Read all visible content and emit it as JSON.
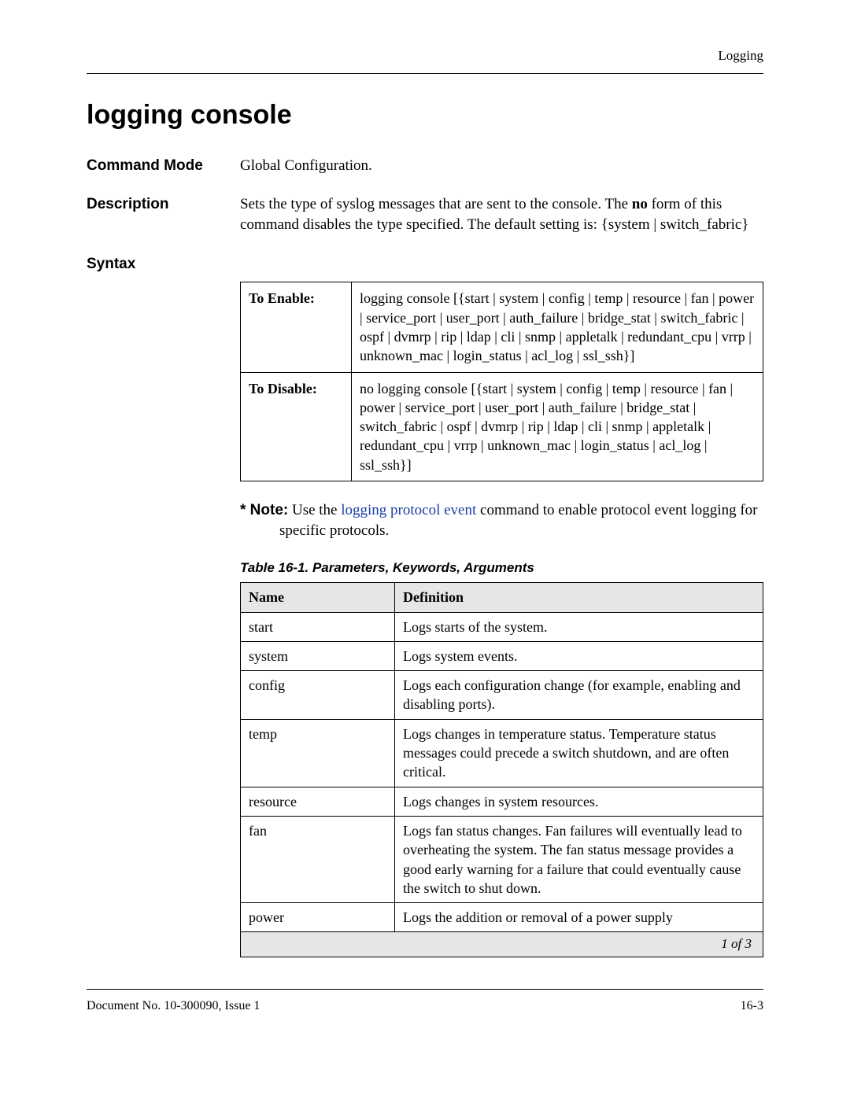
{
  "header_label": "Logging",
  "title": "logging console",
  "command_mode": {
    "label": "Command Mode",
    "value": "Global Configuration."
  },
  "description": {
    "label": "Description",
    "text_pre": "Sets the type of syslog messages that are sent to the console. The ",
    "bold_word": "no",
    "text_post": " form of this command disables the type specified. The default setting is: {system | switch_fabric}"
  },
  "syntax": {
    "label": "Syntax",
    "rows": [
      {
        "label": "To Enable:",
        "text": "logging console [{start | system | config | temp | resource | fan | power | service_port | user_port | auth_failure | bridge_stat | switch_fabric | ospf | dvmrp | rip | ldap | cli | snmp | appletalk | redundant_cpu | vrrp | unknown_mac | login_status | acl_log | ssl_ssh}]"
      },
      {
        "label": "To Disable:",
        "text": "no logging console [{start | system | config | temp | resource | fan | power | service_port | user_port | auth_failure | bridge_stat | switch_fabric | ospf | dvmrp | rip | ldap | cli | snmp | appletalk | redundant_cpu | vrrp | unknown_mac | login_status | acl_log | ssl_ssh}]"
      }
    ]
  },
  "note": {
    "prefix": "* Note:",
    "pre": " Use the ",
    "link": "logging protocol event",
    "post": " command to enable protocol event logging for specific protocols."
  },
  "table_caption": "Table 16-1.  Parameters, Keywords, Arguments",
  "param_headers": {
    "name": "Name",
    "definition": "Definition"
  },
  "params": [
    {
      "name": "start",
      "definition": "Logs starts of the system."
    },
    {
      "name": "system",
      "definition": "Logs system events."
    },
    {
      "name": "config",
      "definition": "Logs each configuration change (for example, enabling and disabling ports)."
    },
    {
      "name": "temp",
      "definition": "Logs changes in temperature status. Temperature status messages could precede a switch shutdown, and are often critical."
    },
    {
      "name": "resource",
      "definition": "Logs changes in system resources."
    },
    {
      "name": "fan",
      "definition": "Logs fan status changes. Fan failures will eventually lead to overheating the system. The fan status message provides a good early warning for a failure that could eventually cause the switch to shut down."
    },
    {
      "name": "power",
      "definition": "Logs the addition or removal of a power supply"
    }
  ],
  "pager": "1 of 3",
  "footer": {
    "left": "Document No. 10-300090, Issue 1",
    "right": "16-3"
  }
}
